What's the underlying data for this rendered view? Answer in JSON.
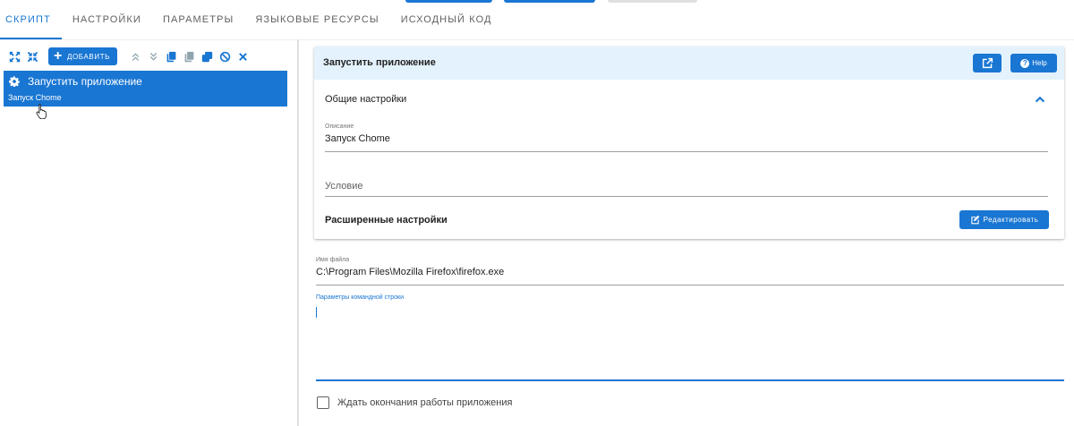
{
  "tabs": [
    {
      "label": "СКРИПТ",
      "active": true
    },
    {
      "label": "НАСТРОЙКИ",
      "active": false
    },
    {
      "label": "ПАРАМЕТРЫ",
      "active": false
    },
    {
      "label": "ЯЗЫКОВЫЕ РЕСУРСЫ",
      "active": false
    },
    {
      "label": "ИСХОДНЫЙ КОД",
      "active": false
    }
  ],
  "toolbar": {
    "add_label": "ДОБАВИТЬ",
    "icons": [
      "expand-all-icon",
      "collapse-all-icon",
      "move-up-icon",
      "move-down-icon",
      "copy-icon",
      "paste-icon",
      "duplicate-icon",
      "disable-icon",
      "delete-icon"
    ]
  },
  "tree": {
    "items": [
      {
        "title": "Запустить приложение",
        "subtitle": "Запуск Chome",
        "icon": "gear-icon",
        "selected": true
      }
    ]
  },
  "panel": {
    "title": "Запустить приложение",
    "help_label": "Help",
    "general_section": "Общие настройки",
    "description": {
      "label": "Описание",
      "value": "Запуск Chome"
    },
    "condition": {
      "placeholder": "Условие"
    },
    "advanced_section": "Расширенные настройки",
    "edit_label": "Редактировать"
  },
  "filename": {
    "label": "Имя файла",
    "value": "C:\\Program Files\\Mozilla Firefox\\firefox.exe"
  },
  "cmdline": {
    "label": "Параметры командной строки",
    "value": ""
  },
  "wait": {
    "label": "Ждать окончания работы приложения",
    "checked": false
  },
  "colors": {
    "accent": "#1976d2",
    "header_bg": "#e3f2fd"
  }
}
